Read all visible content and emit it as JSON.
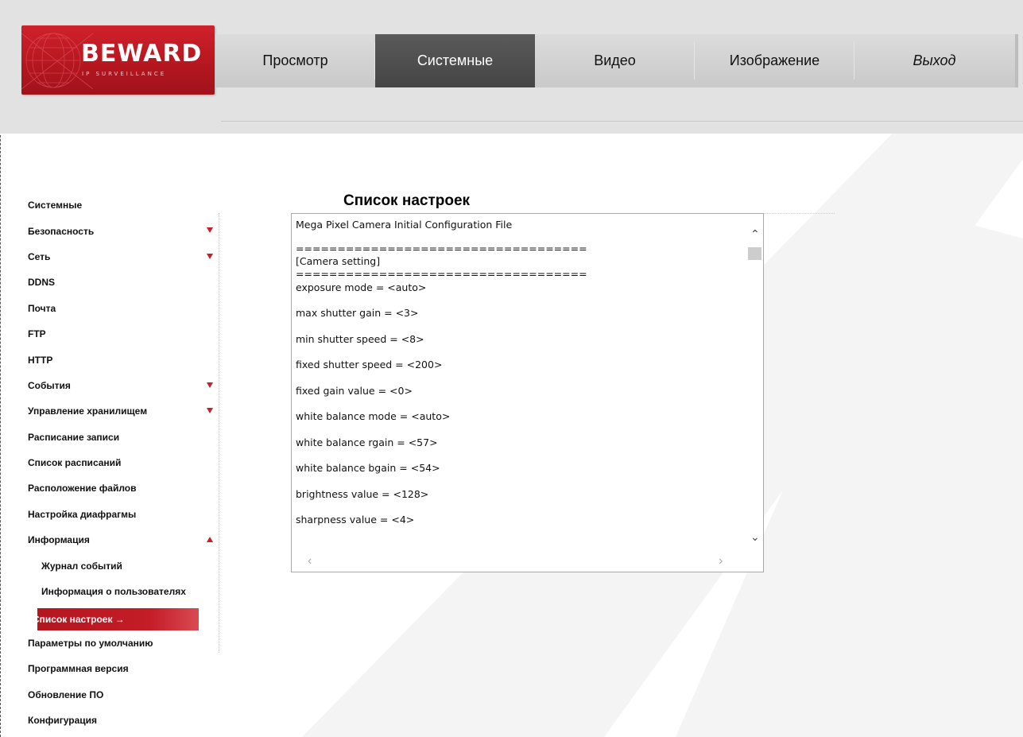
{
  "logo": {
    "brand": "BEWARD",
    "tagline": "IP SURVEILLANCE"
  },
  "topnav": {
    "tabs": [
      {
        "label": "Просмотр"
      },
      {
        "label": "Системные"
      },
      {
        "label": "Видео"
      },
      {
        "label": "Изображение"
      },
      {
        "label": "Выход"
      }
    ],
    "active": "Системные"
  },
  "sidebar": {
    "items": [
      {
        "label": "Системные"
      },
      {
        "label": "Безопасность"
      },
      {
        "label": "Сеть"
      },
      {
        "label": "DDNS"
      },
      {
        "label": "Почта"
      },
      {
        "label": "FTP"
      },
      {
        "label": "HTTP"
      },
      {
        "label": "События"
      },
      {
        "label": "Управление хранилищем"
      },
      {
        "label": "Расписание записи"
      },
      {
        "label": "Список расписаний"
      },
      {
        "label": "Расположение файлов"
      },
      {
        "label": "Настройка диафрагмы"
      },
      {
        "label": "Информация"
      },
      {
        "label": "Журнал событий"
      },
      {
        "label": "Информация о пользователях"
      },
      {
        "label": "Список настроек →"
      },
      {
        "label": "Параметры по умолчанию"
      },
      {
        "label": "Программная версия"
      },
      {
        "label": "Обновление ПО"
      },
      {
        "label": "Конфигурация"
      }
    ]
  },
  "panel": {
    "title": "Список настроек",
    "lines": [
      "Mega Pixel Camera Initial Configuration File",
      "===================================",
      "[Camera setting]",
      "===================================",
      "exposure mode = <auto>",
      "max shutter gain = <3>",
      "min shutter speed = <8>",
      "fixed shutter speed = <200>",
      "fixed gain value = <0>",
      "white balance mode = <auto>",
      "white balance rgain = <57>",
      "white balance bgain = <54>",
      "brightness value = <128>",
      "sharpness value = <4>"
    ]
  },
  "colors": {
    "accent": "#c41d28",
    "active_tab": "#4e4e4e",
    "header_bg": "#e2e2e2"
  }
}
